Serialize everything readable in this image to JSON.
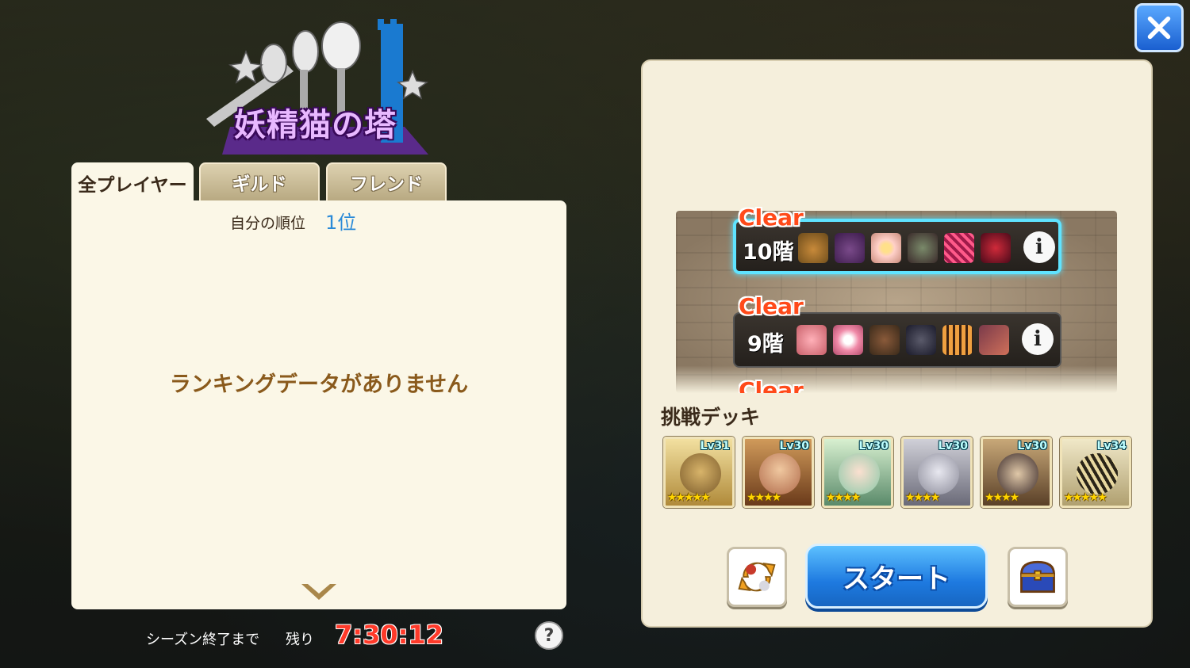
{
  "title": "妖精猫の塔",
  "tabs": [
    {
      "label": "全プレイヤー",
      "active": true
    },
    {
      "label": "ギルド",
      "active": false
    },
    {
      "label": "フレンド",
      "active": false
    }
  ],
  "ranking": {
    "my_rank_label": "自分の順位",
    "my_rank_value": "1位",
    "empty_message": "ランキングデータがありません"
  },
  "season": {
    "label": "シーズン終了まで",
    "remain_label": "残り",
    "timer": "7:30:12"
  },
  "help_label": "?",
  "floors": [
    {
      "clear_label": "Clear",
      "floor": "10階",
      "selected": true,
      "enemies": [
        "toad-enemy-icon",
        "purple-beast-enemy-icon",
        "flower-enemy-icon",
        "armored-enemy-icon",
        "butterfly-enemy-icon",
        "red-dragon-enemy-icon"
      ],
      "info_label": "i"
    },
    {
      "clear_label": "Clear",
      "floor": "9階",
      "selected": false,
      "enemies": [
        "pink-pig-enemy-icon",
        "pink-egg-enemy-icon",
        "boar-enemy-icon",
        "dark-knight-enemy-icon",
        "tiger-enemy-icon",
        "fish-enemy-icon"
      ],
      "info_label": "i"
    }
  ],
  "partial_clear_label": "Clear",
  "deck": {
    "title": "挑戦デッキ",
    "cards": [
      {
        "level": "Lv31",
        "stars": "★★★★★",
        "icon": "frog-sage-icon"
      },
      {
        "level": "Lv30",
        "stars": "★★★★",
        "icon": "elf-warrior-icon"
      },
      {
        "level": "Lv30",
        "stars": "★★★★",
        "icon": "green-hair-girl-icon"
      },
      {
        "level": "Lv30",
        "stars": "★★★★",
        "icon": "gray-cat-icon"
      },
      {
        "level": "Lv30",
        "stars": "★★★★",
        "icon": "dark-cat-icon"
      },
      {
        "level": "Lv34",
        "stars": "★★★★★",
        "icon": "moth-icon"
      }
    ]
  },
  "start_label": "スタート",
  "colors": {
    "accent_blue": "#1e7ae0",
    "timer_red": "#ff3a2a",
    "clear_red": "#ff4a1a",
    "panel_bg": "#fbf7e7",
    "selected_glow": "#5fe3ff"
  }
}
